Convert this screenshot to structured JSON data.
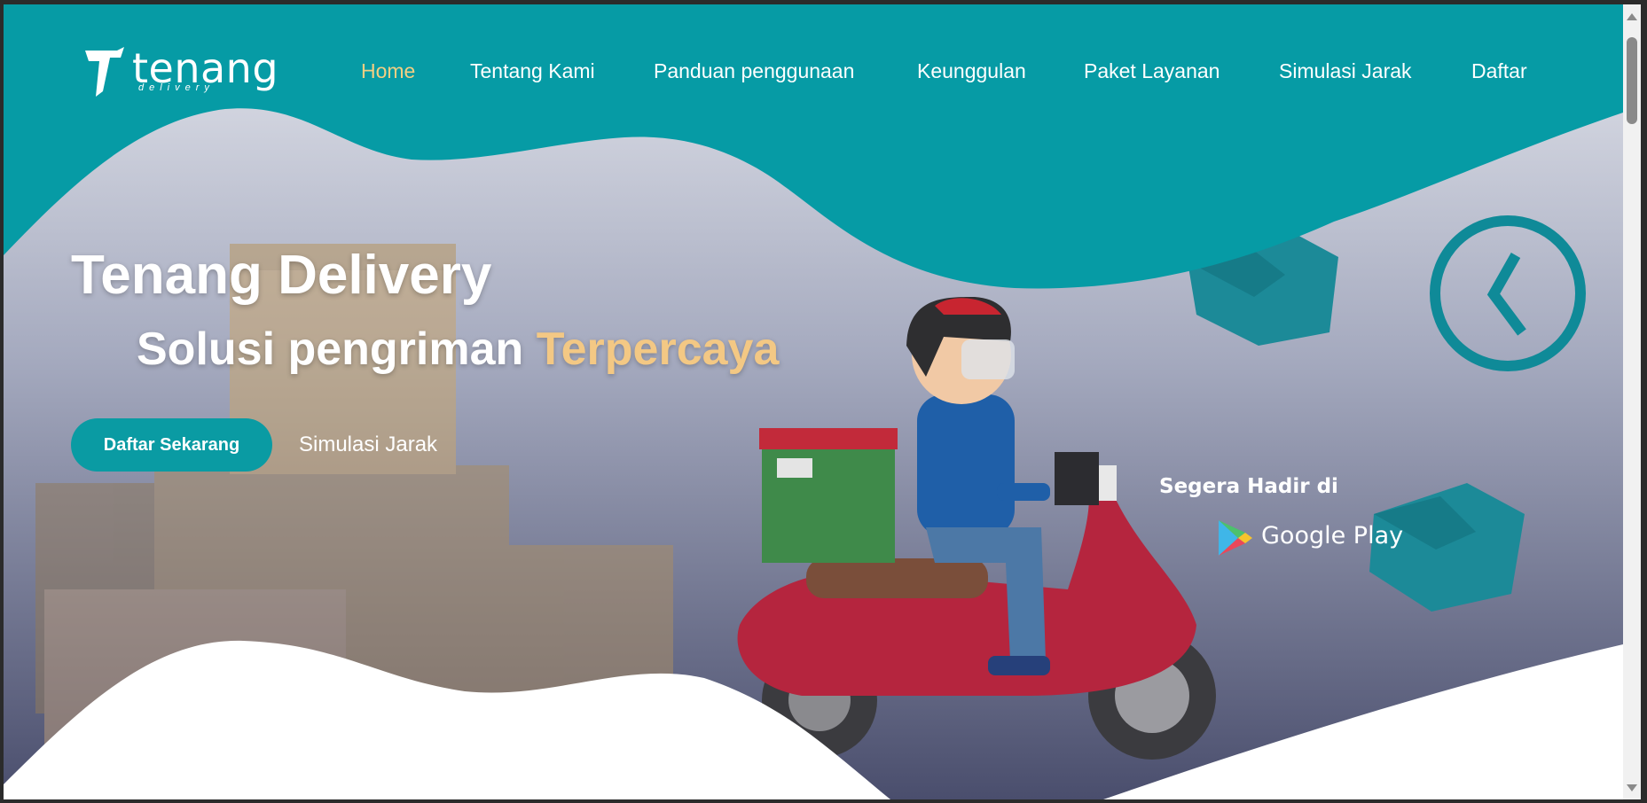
{
  "logo": {
    "name": "tenang",
    "tagline": "delivery"
  },
  "nav": [
    {
      "label": "Home",
      "active": true
    },
    {
      "label": "Tentang Kami"
    },
    {
      "label": "Panduan penggunaan"
    },
    {
      "label": "Keunggulan"
    },
    {
      "label": "Paket Layanan"
    },
    {
      "label": "Simulasi Jarak"
    },
    {
      "label": "Daftar"
    }
  ],
  "hero": {
    "title": "Tenang Delivery",
    "subtitle_main": "Solusi pengriman ",
    "subtitle_accent": "Terpercaya",
    "primary_button": "Daftar Sekarang",
    "secondary_link": "Simulasi Jarak",
    "coming_soon": "Segera Hadir di",
    "store": "Google Play"
  },
  "icons": [
    "logo-t-icon",
    "box-icon",
    "clock-icon",
    "google-play-icon"
  ],
  "colors": {
    "teal": "#0a9ba3",
    "accent": "#f3c884",
    "nav_active": "#f3cf83"
  }
}
